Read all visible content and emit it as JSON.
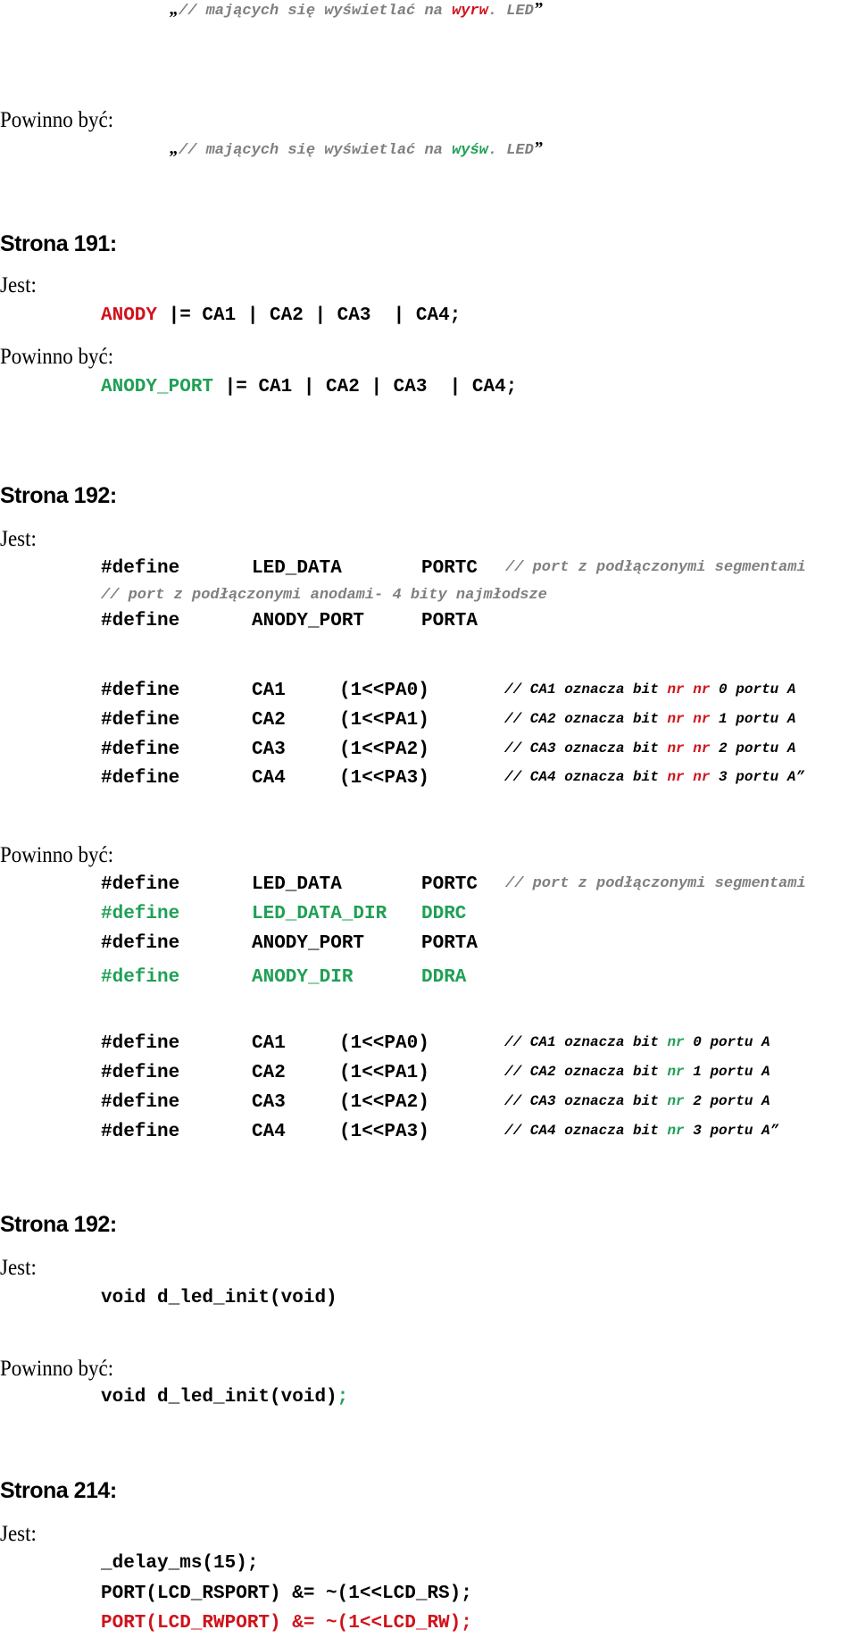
{
  "colors": {
    "error": "#d0121b",
    "fix": "#1fa055",
    "comment": "#7f7f7f",
    "text": "#000000"
  },
  "blocks": [
    {
      "id": "p0-wrong",
      "type": "quote",
      "segments": [
        {
          "t": "„",
          "c": "qmark"
        },
        {
          "t": "// mających się wyświetlać na ",
          "c": "gray"
        },
        {
          "t": "wyrw",
          "c": "red"
        },
        {
          "t": ". LED",
          "c": "gray"
        },
        {
          "t": "”",
          "c": "qmark"
        }
      ]
    },
    {
      "id": "p0-should-label",
      "type": "label",
      "text": "Powinno być:"
    },
    {
      "id": "p0-right",
      "type": "quote",
      "segments": [
        {
          "t": "„",
          "c": "qmark"
        },
        {
          "t": "// mających się wyświetlać na ",
          "c": "gray"
        },
        {
          "t": "wyśw",
          "c": "green"
        },
        {
          "t": ". LED",
          "c": "gray"
        },
        {
          "t": "”",
          "c": "qmark"
        }
      ]
    },
    {
      "id": "s191-heading",
      "type": "heading",
      "text": "Strona 191:"
    },
    {
      "id": "s191-is-label",
      "type": "label",
      "text": "Jest:"
    },
    {
      "id": "s191-wrong",
      "type": "code",
      "segments": [
        {
          "t": "ANODY",
          "c": "red"
        },
        {
          "t": " |= CA1 | CA2 | CA3  | CA4;",
          "c": "black"
        }
      ]
    },
    {
      "id": "s191-should-label",
      "type": "label",
      "text": "Powinno być:"
    },
    {
      "id": "s191-right",
      "type": "code",
      "segments": [
        {
          "t": "ANODY_PORT",
          "c": "green"
        },
        {
          "t": " |= CA1 | CA2 | CA3  | CA4;",
          "c": "black"
        }
      ]
    },
    {
      "id": "s192a-heading",
      "type": "heading",
      "text": "Strona 192:"
    },
    {
      "id": "s192a-is-label",
      "type": "label",
      "text": "Jest:"
    },
    {
      "id": "s192a-wrong-1",
      "type": "define",
      "cols": [
        {
          "t": "#define",
          "c": "black"
        },
        {
          "t": "LED_DATA",
          "c": "black"
        },
        {
          "t": "PORTC",
          "c": "black"
        },
        {
          "t": "// port z podłączonymi segmentami",
          "c": "cmt"
        }
      ]
    },
    {
      "id": "s192a-wrong-2",
      "type": "comment",
      "text": "// port z podłączonymi anodami- 4 bity najmłodsze"
    },
    {
      "id": "s192a-wrong-3",
      "type": "define",
      "cols": [
        {
          "t": "#define",
          "c": "black"
        },
        {
          "t": "ANODY_PORT",
          "c": "black"
        },
        {
          "t": "PORTA",
          "c": "black"
        }
      ]
    },
    {
      "id": "s192a-wrong-ca1",
      "type": "cadef",
      "cols": [
        "#define",
        "CA1",
        "(1<<PA0)"
      ],
      "comment": [
        {
          "t": "// CA1 oznacza bit ",
          "c": "black"
        },
        {
          "t": "nr nr",
          "c": "red"
        },
        {
          "t": " 0 portu A",
          "c": "black"
        }
      ]
    },
    {
      "id": "s192a-wrong-ca2",
      "type": "cadef",
      "cols": [
        "#define",
        "CA2",
        "(1<<PA1)"
      ],
      "comment": [
        {
          "t": "// CA2 oznacza bit ",
          "c": "black"
        },
        {
          "t": "nr nr",
          "c": "red"
        },
        {
          "t": " 1 portu A",
          "c": "black"
        }
      ]
    },
    {
      "id": "s192a-wrong-ca3",
      "type": "cadef",
      "cols": [
        "#define",
        "CA3",
        "(1<<PA2)"
      ],
      "comment": [
        {
          "t": "// CA3 oznacza bit ",
          "c": "black"
        },
        {
          "t": "nr nr",
          "c": "red"
        },
        {
          "t": " 2 portu A",
          "c": "black"
        }
      ]
    },
    {
      "id": "s192a-wrong-ca4",
      "type": "cadef",
      "cols": [
        "#define",
        "CA4",
        "(1<<PA3)"
      ],
      "comment": [
        {
          "t": "// CA4 oznacza bit ",
          "c": "black"
        },
        {
          "t": "nr nr",
          "c": "red"
        },
        {
          "t": " 3 portu A”",
          "c": "black"
        }
      ]
    },
    {
      "id": "s192a-should-label",
      "type": "label",
      "text": "Powinno być:"
    },
    {
      "id": "s192a-right-1",
      "type": "define",
      "cols": [
        {
          "t": "#define",
          "c": "black"
        },
        {
          "t": "LED_DATA",
          "c": "black"
        },
        {
          "t": "PORTC",
          "c": "black"
        },
        {
          "t": "// port z podłączonymi segmentami",
          "c": "cmt"
        }
      ]
    },
    {
      "id": "s192a-right-2",
      "type": "define",
      "cols": [
        {
          "t": "#define",
          "c": "green"
        },
        {
          "t": "LED_DATA_DIR",
          "c": "green"
        },
        {
          "t": "DDRC",
          "c": "green"
        }
      ]
    },
    {
      "id": "s192a-right-3",
      "type": "define",
      "cols": [
        {
          "t": "#define",
          "c": "black"
        },
        {
          "t": "ANODY_PORT",
          "c": "black"
        },
        {
          "t": "PORTA",
          "c": "black"
        }
      ]
    },
    {
      "id": "s192a-right-4",
      "type": "define",
      "cols": [
        {
          "t": "#define",
          "c": "green"
        },
        {
          "t": "ANODY_DIR",
          "c": "green"
        },
        {
          "t": "DDRA",
          "c": "green"
        }
      ]
    },
    {
      "id": "s192a-right-ca1",
      "type": "cadef",
      "cols": [
        "#define",
        "CA1",
        "(1<<PA0)"
      ],
      "comment": [
        {
          "t": "// CA1 oznacza bit ",
          "c": "black"
        },
        {
          "t": "nr",
          "c": "green"
        },
        {
          "t": " 0 portu A",
          "c": "black"
        }
      ]
    },
    {
      "id": "s192a-right-ca2",
      "type": "cadef",
      "cols": [
        "#define",
        "CA2",
        "(1<<PA1)"
      ],
      "comment": [
        {
          "t": "// CA2 oznacza bit ",
          "c": "black"
        },
        {
          "t": "nr",
          "c": "green"
        },
        {
          "t": " 1 portu A",
          "c": "black"
        }
      ]
    },
    {
      "id": "s192a-right-ca3",
      "type": "cadef",
      "cols": [
        "#define",
        "CA3",
        "(1<<PA2)"
      ],
      "comment": [
        {
          "t": "// CA3 oznacza bit ",
          "c": "black"
        },
        {
          "t": "nr",
          "c": "green"
        },
        {
          "t": " 2 portu A",
          "c": "black"
        }
      ]
    },
    {
      "id": "s192a-right-ca4",
      "type": "cadef",
      "cols": [
        "#define",
        "CA4",
        "(1<<PA3)"
      ],
      "comment": [
        {
          "t": "// CA4 oznacza bit ",
          "c": "black"
        },
        {
          "t": "nr",
          "c": "green"
        },
        {
          "t": " 3 portu A”",
          "c": "black"
        }
      ]
    },
    {
      "id": "s192b-heading",
      "type": "heading",
      "text": "Strona 192:"
    },
    {
      "id": "s192b-is-label",
      "type": "label",
      "text": "Jest:"
    },
    {
      "id": "s192b-wrong",
      "type": "code",
      "segments": [
        {
          "t": "void d_led_init(void)",
          "c": "black"
        }
      ]
    },
    {
      "id": "s192b-should-label",
      "type": "label",
      "text": "Powinno być:"
    },
    {
      "id": "s192b-right",
      "type": "code",
      "segments": [
        {
          "t": "void d_led_init(void)",
          "c": "black"
        },
        {
          "t": ";",
          "c": "green"
        }
      ]
    },
    {
      "id": "s214-heading",
      "type": "heading",
      "text": "Strona 214:"
    },
    {
      "id": "s214-is-label",
      "type": "label",
      "text": "Jest:"
    },
    {
      "id": "s214-wrong-1",
      "type": "code",
      "segments": [
        {
          "t": "_delay_ms(15);",
          "c": "black"
        }
      ]
    },
    {
      "id": "s214-wrong-2",
      "type": "code",
      "segments": [
        {
          "t": "PORT(LCD_RSPORT) &= ~(1<<LCD_RS);",
          "c": "black"
        }
      ]
    },
    {
      "id": "s214-wrong-3",
      "type": "code",
      "segments": [
        {
          "t": "PORT(LCD_RWPORT) &= ~(1<<LCD_RW);",
          "c": "red"
        }
      ]
    }
  ]
}
